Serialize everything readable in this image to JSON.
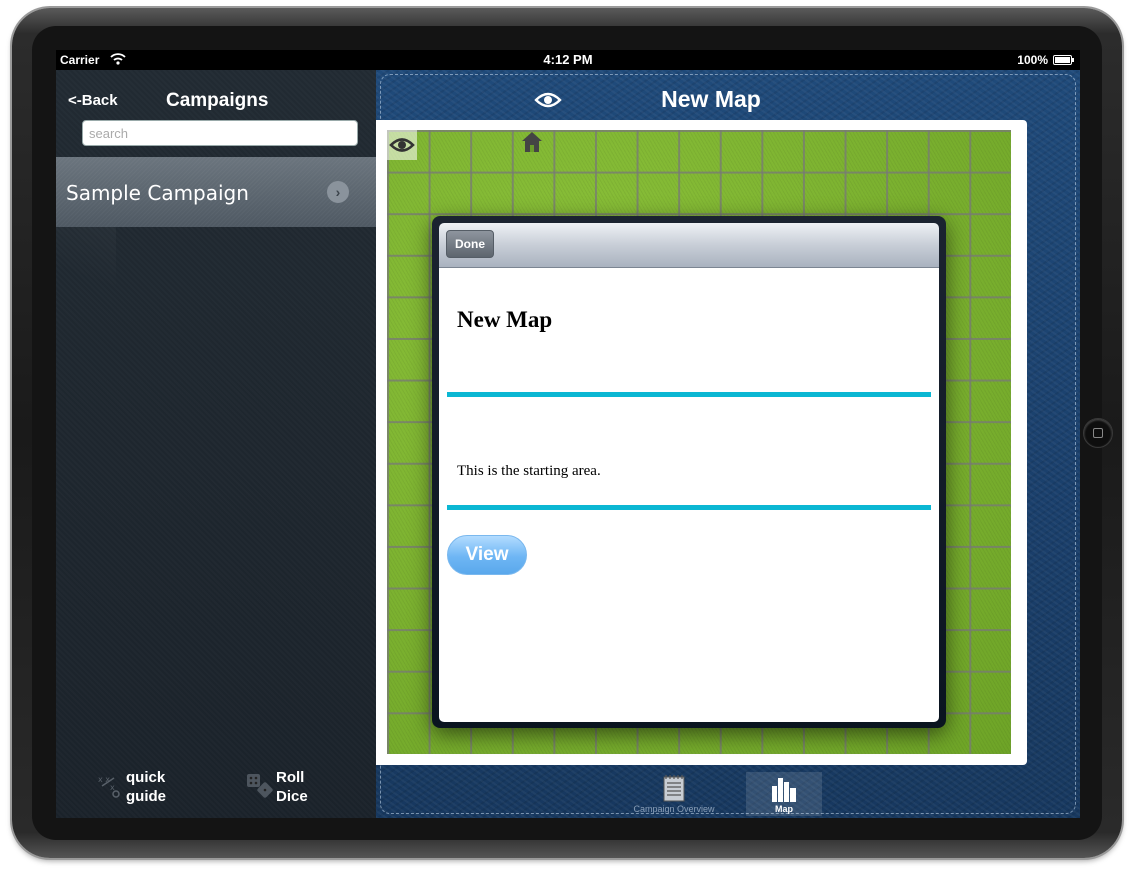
{
  "status_bar": {
    "carrier": "Carrier",
    "time": "4:12 PM",
    "battery": "100%"
  },
  "left_panel": {
    "back_label": "<-Back",
    "title": "Campaigns",
    "search_placeholder": "search",
    "search_value": "",
    "items": [
      {
        "label": "Sample Campaign"
      }
    ],
    "tools": [
      {
        "label_line1": "quick",
        "label_line2": "guide",
        "icon": "quick-guide-icon"
      },
      {
        "label_line1": "Roll",
        "label_line2": "Dice",
        "icon": "dice-icon"
      }
    ]
  },
  "map_view": {
    "title": "New Map",
    "popover": {
      "done_label": "Done",
      "heading": "New Map",
      "text": "This is the starting area.",
      "view_label": "View"
    },
    "tabs": [
      {
        "label": "Campaign Overview",
        "icon": "notepad-icon",
        "selected": false
      },
      {
        "label": "Map",
        "icon": "city-icon",
        "selected": true
      }
    ]
  },
  "colors": {
    "accent_divider": "#0bb7d3",
    "view_button": "#6eb6f4",
    "grass": "#7ab02e",
    "leather": "#1f4a7a"
  }
}
